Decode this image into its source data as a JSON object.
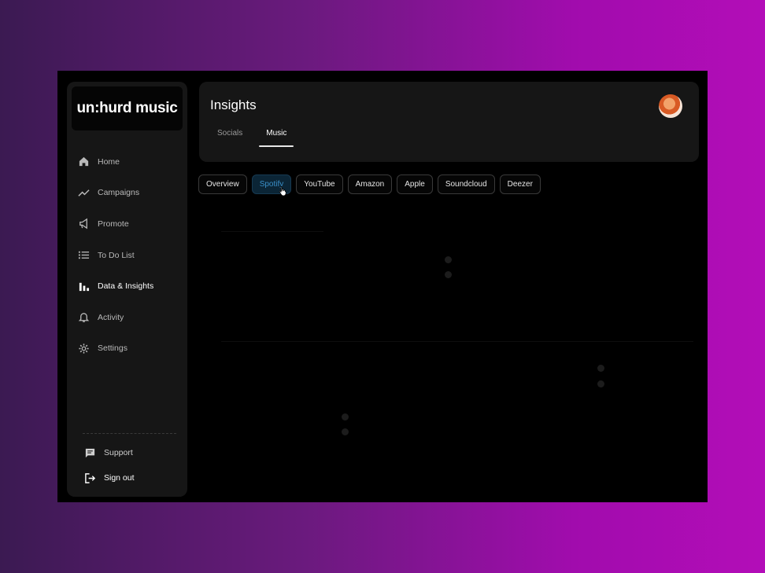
{
  "brand": {
    "logo_text": "un:hurd music"
  },
  "sidebar": {
    "items": [
      {
        "label": "Home",
        "icon": "home-icon"
      },
      {
        "label": "Campaigns",
        "icon": "trending-up-icon"
      },
      {
        "label": "Promote",
        "icon": "megaphone-icon"
      },
      {
        "label": "To Do List",
        "icon": "list-icon"
      },
      {
        "label": "Data & Insights",
        "icon": "bar-chart-icon",
        "active": true
      },
      {
        "label": "Activity",
        "icon": "bell-icon"
      },
      {
        "label": "Settings",
        "icon": "gear-icon"
      }
    ],
    "bottom": [
      {
        "label": "Support",
        "icon": "chat-icon"
      },
      {
        "label": "Sign out",
        "icon": "sign-out-icon"
      }
    ]
  },
  "header": {
    "title": "Insights",
    "tabs": [
      {
        "label": "Socials"
      },
      {
        "label": "Music",
        "active": true
      }
    ]
  },
  "platforms": [
    {
      "label": "Overview"
    },
    {
      "label": "Spotify",
      "active": true
    },
    {
      "label": "YouTube"
    },
    {
      "label": "Amazon"
    },
    {
      "label": "Apple"
    },
    {
      "label": "Soundcloud"
    },
    {
      "label": "Deezer"
    }
  ],
  "colors": {
    "accent": "#3a8fc8",
    "panel": "#161616",
    "background_start": "#3b1a52",
    "background_end": "#b30db8"
  }
}
